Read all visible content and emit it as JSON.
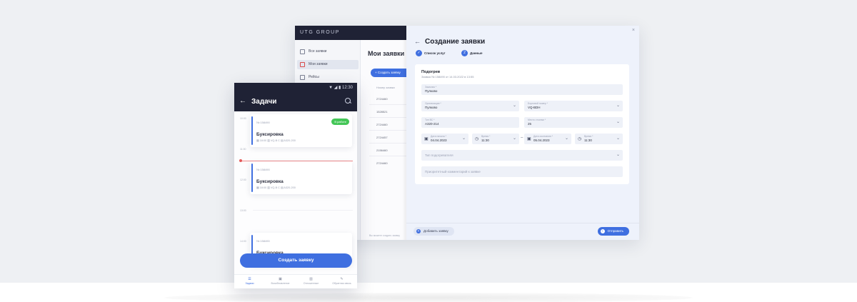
{
  "desktop": {
    "brand": "UTG GROUP",
    "sidebar": {
      "items": [
        {
          "label": "Все заявки",
          "icon": "grid-icon",
          "active": false
        },
        {
          "label": "Мои заявки",
          "icon": "requests-icon",
          "active": true
        },
        {
          "label": "Рейсы",
          "icon": "flights-icon",
          "active": false
        }
      ]
    },
    "main": {
      "title": "Мои заявки",
      "create_button": "+ Создать заявку",
      "column_header": "Номер заявки",
      "rows": [
        "2724460",
        "1528521",
        "2724460",
        "2724457",
        "2156460",
        "2724460"
      ],
      "footer_note": "Вы можете создать заявку"
    },
    "panel": {
      "close": "×",
      "back": "←",
      "title": "Создание заявки",
      "steps": [
        {
          "marker": "✓",
          "label": "Список услуг"
        },
        {
          "marker": "2",
          "label": "Данные"
        }
      ],
      "section": {
        "title": "Подогрев",
        "subtitle": "Заявка № 158490 от 14.03.2022 в 13:55"
      },
      "fields": {
        "service": {
          "label": "Заказчик *",
          "value": "Пулково"
        },
        "company": {
          "label": "Организация *",
          "value": "Пулково"
        },
        "board": {
          "label": "Бортовой номер *",
          "value": "VQ-BDH"
        },
        "aircraft": {
          "label": "Тип ВС *",
          "value": "A320-214"
        },
        "stand": {
          "label": "Место стоянки *",
          "value": "25"
        },
        "date_from": {
          "label": "Дата начала *",
          "value": "04.04.2023"
        },
        "time_from": {
          "label": "Время *",
          "value": "11:30"
        },
        "date_to": {
          "label": "Дата окончания *",
          "value": "05.04.2023"
        },
        "time_to": {
          "label": "Время *",
          "value": "11:30"
        },
        "extra_placeholder": "Тип подогревателя",
        "comment_placeholder": "Приоритетный комментарий к заявке"
      },
      "footer": {
        "add_label": "Добавить заявку",
        "send_label": "Отправить"
      }
    }
  },
  "phone": {
    "status_icons": "▼ ◢ ▮ 12:30",
    "title": "Задачи",
    "times": [
      "10:00",
      "11:00",
      "12:00",
      "13:00",
      "14:00"
    ],
    "tasks": [
      {
        "number": "№ 158490",
        "name": "Буксировка",
        "meta": "▦ 18:00  ▥ VQ-B C  ▤ A320-200",
        "badge": "В работе"
      },
      {
        "number": "№ 158490",
        "name": "Буксировка",
        "meta": "▦ 18:00  ▥ VQ-B C  ▤ A320-200",
        "badge": ""
      },
      {
        "number": "№ 158490",
        "name": "Буксировка",
        "meta": "",
        "badge": ""
      }
    ],
    "create_button": "Создать заявку",
    "nav": [
      {
        "label": "Задачи",
        "icon": "tasks-icon",
        "glyph": "☰",
        "active": true
      },
      {
        "label": "Возобновление",
        "icon": "briefcase-icon",
        "glyph": "▣",
        "active": false
      },
      {
        "label": "Отложенные",
        "icon": "trash-icon",
        "glyph": "▥",
        "active": false
      },
      {
        "label": "Обратная связь",
        "icon": "pencil-icon",
        "glyph": "✎",
        "active": false
      }
    ]
  },
  "colors": {
    "accent": "#3f6fe0",
    "dark": "#1f2235",
    "success": "#44c657",
    "now_line": "#ef8a8a"
  }
}
